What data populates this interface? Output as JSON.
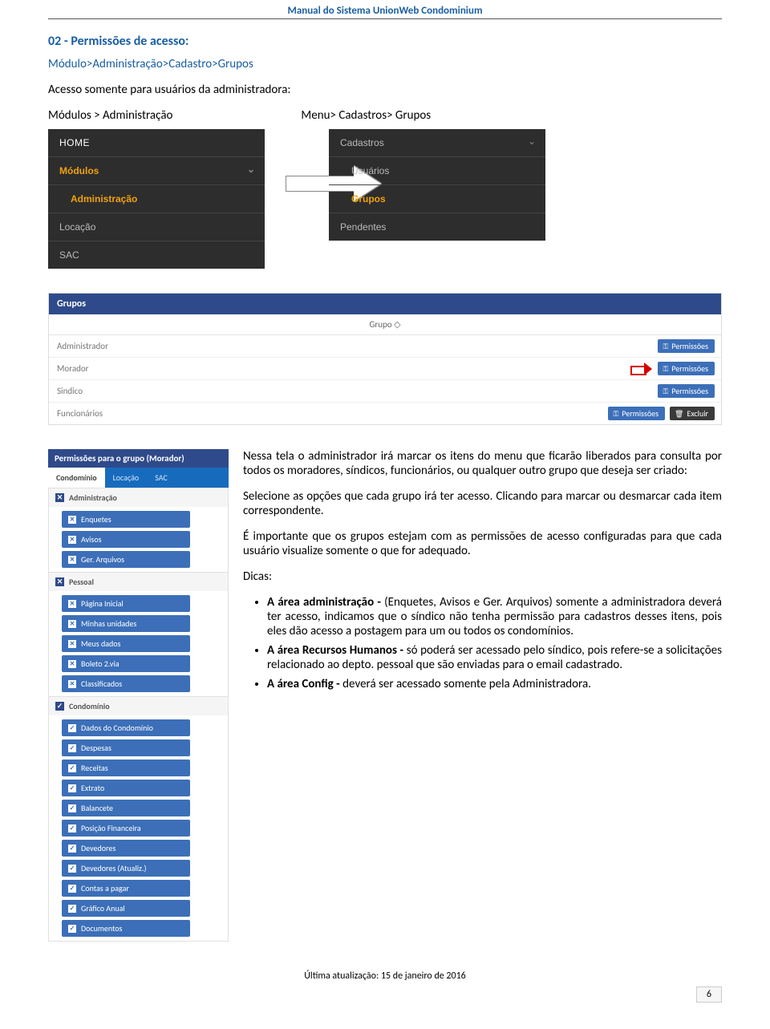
{
  "header": {
    "title": "Manual do Sistema UnionWeb Condominium"
  },
  "section": {
    "title": "02 - Permissões de acesso:",
    "breadcrumb": "Módulo>Administração>Cadastro>Grupos",
    "note": "Acesso somente para usuários da administradora:",
    "left_label": "Módulos > Administração",
    "right_label": "Menu> Cadastros> Grupos"
  },
  "menu_left": {
    "home": "HOME",
    "modulos": "Módulos",
    "administracao": "Administração",
    "locacao": "Locação",
    "sac": "SAC"
  },
  "menu_right": {
    "cadastros": "Cadastros",
    "usuarios": "Usuários",
    "grupos": "Grupos",
    "pendentes": "Pendentes"
  },
  "grupos_table": {
    "title": "Grupos",
    "col": "Grupo ◇",
    "rows": [
      "Administrador",
      "Morador",
      "Sindico",
      "Funcionários"
    ],
    "btn_perm": "Permissões",
    "btn_del": "Excluir"
  },
  "perm_panel": {
    "title": "Permissões para o grupo (Morador)",
    "tabs": [
      "Condomínio",
      "Locação",
      "SAC"
    ],
    "groups": [
      {
        "label": "Administração",
        "checked": false,
        "items": [
          {
            "label": "Enquetes",
            "checked": false
          },
          {
            "label": "Avisos",
            "checked": false
          },
          {
            "label": "Ger. Arquivos",
            "checked": false
          }
        ]
      },
      {
        "label": "Pessoal",
        "checked": false,
        "items": [
          {
            "label": "Página Inicial",
            "checked": false
          },
          {
            "label": "Minhas unidades",
            "checked": false
          },
          {
            "label": "Meus dados",
            "checked": false
          },
          {
            "label": "Boleto 2.via",
            "checked": false
          },
          {
            "label": "Classificados",
            "checked": false
          }
        ]
      },
      {
        "label": "Condomínio",
        "checked": true,
        "items": [
          {
            "label": "Dados do Condomínio",
            "checked": true
          },
          {
            "label": "Despesas",
            "checked": true
          },
          {
            "label": "Receitas",
            "checked": true
          },
          {
            "label": "Extrato",
            "checked": true
          },
          {
            "label": "Balancete",
            "checked": true
          },
          {
            "label": "Posição Financeira",
            "checked": true
          },
          {
            "label": "Devedores",
            "checked": true
          },
          {
            "label": "Devedores (Atualiz.)",
            "checked": true
          },
          {
            "label": "Contas a pagar",
            "checked": true
          },
          {
            "label": "Gráfico Anual",
            "checked": true
          },
          {
            "label": "Documentos",
            "checked": true
          }
        ]
      }
    ]
  },
  "body": {
    "p1": "Nessa tela o administrador irá marcar os itens do menu que ficarão liberados para consulta por todos os moradores, síndicos, funcionários, ou qualquer outro grupo que deseja ser criado:",
    "p2": "Selecione as opções que cada grupo irá ter acesso. Clicando para marcar ou desmarcar cada item correspondente.",
    "p3": "É importante que os grupos estejam com as permissões de acesso configuradas para que cada usuário visualize somente o que for adequado.",
    "dicas_label": "Dicas:",
    "bullets": [
      {
        "bold": "A área administração - ",
        "rest": "(Enquetes, Avisos e Ger. Arquivos) somente a administradora deverá ter acesso, indicamos que o síndico não tenha permissão para cadastros desses itens, pois eles dão acesso a postagem para um ou todos os condomínios."
      },
      {
        "bold": "A área Recursos Humanos - ",
        "rest": "só poderá ser acessado pelo síndico, pois refere-se a solicitações relacionado ao depto. pessoal que são enviadas para o email cadastrado."
      },
      {
        "bold": "A área Config - ",
        "rest": "deverá ser acessado somente pela Administradora."
      }
    ]
  },
  "footer": {
    "updated": "Última atualização: 15 de janeiro de 2016",
    "page": "6"
  }
}
